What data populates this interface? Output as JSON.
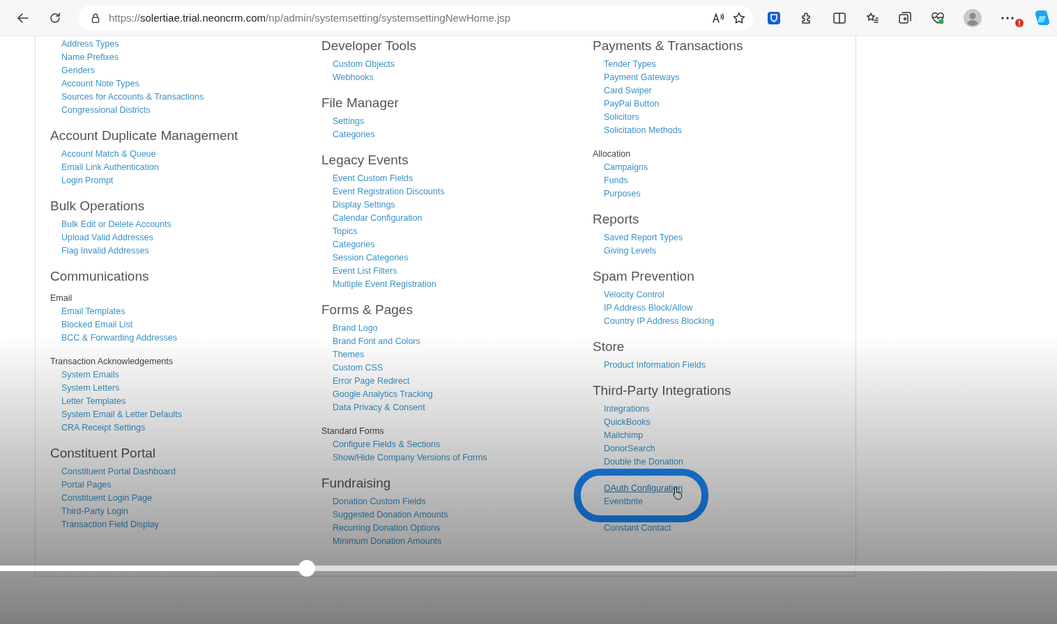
{
  "browser": {
    "url_scheme": "https://",
    "url_domain": "solertiae.trial.neoncrm.com",
    "url_path": "/np/admin/systemsetting/systemsettingNewHome.jsp"
  },
  "columns": [
    {
      "sections": [
        {
          "kind": "none",
          "links": [
            {
              "label": "Address Types"
            },
            {
              "label": "Name Prefixes"
            },
            {
              "label": "Genders"
            },
            {
              "label": "Account Note Types"
            },
            {
              "label": "Sources for Accounts & Transactions"
            },
            {
              "label": "Congressional Districts"
            }
          ]
        },
        {
          "kind": "heading",
          "title": "Account Duplicate Management",
          "links": [
            {
              "label": "Account Match & Queue"
            },
            {
              "label": "Email Link Authentication"
            },
            {
              "label": "Login Prompt"
            }
          ]
        },
        {
          "kind": "heading",
          "title": "Bulk Operations",
          "links": [
            {
              "label": "Bulk Edit or Delete Accounts"
            },
            {
              "label": "Upload Valid Addresses"
            },
            {
              "label": "Flag Invalid Addresses"
            }
          ]
        },
        {
          "kind": "heading",
          "title": "Communications"
        },
        {
          "kind": "subheading",
          "title": "Email",
          "links": [
            {
              "label": "Email Templates"
            },
            {
              "label": "Blocked Email List"
            },
            {
              "label": "BCC & Forwarding Addresses"
            }
          ]
        },
        {
          "kind": "subheading",
          "title": "Transaction Acknowledgements",
          "links": [
            {
              "label": "System Emails"
            },
            {
              "label": "System Letters"
            },
            {
              "label": "Letter Templates"
            },
            {
              "label": "System Email & Letter Defaults"
            },
            {
              "label": "CRA Receipt Settings"
            }
          ]
        },
        {
          "kind": "heading",
          "title": "Constituent Portal",
          "links": [
            {
              "label": "Constituent Portal Dashboard"
            },
            {
              "label": "Portal Pages"
            },
            {
              "label": "Constituent Login Page"
            },
            {
              "label": "Third-Party Login"
            },
            {
              "label": "Transaction Field Display"
            }
          ]
        }
      ]
    },
    {
      "sections": [
        {
          "kind": "heading",
          "title": "Developer Tools",
          "links": [
            {
              "label": "Custom Objects"
            },
            {
              "label": "Webhooks"
            }
          ]
        },
        {
          "kind": "heading",
          "title": "File Manager",
          "links": [
            {
              "label": "Settings"
            },
            {
              "label": "Categories"
            }
          ]
        },
        {
          "kind": "heading",
          "title": "Legacy Events",
          "links": [
            {
              "label": "Event Custom Fields"
            },
            {
              "label": "Event Registration Discounts"
            },
            {
              "label": "Display Settings"
            },
            {
              "label": "Calendar Configuration"
            },
            {
              "label": "Topics"
            },
            {
              "label": "Categories"
            },
            {
              "label": "Session Categories"
            },
            {
              "label": "Event List Filters"
            },
            {
              "label": "Multiple Event Registration"
            }
          ]
        },
        {
          "kind": "heading",
          "title": "Forms & Pages",
          "links": [
            {
              "label": "Brand Logo"
            },
            {
              "label": "Brand Font and Colors"
            },
            {
              "label": "Themes"
            },
            {
              "label": "Custom CSS"
            },
            {
              "label": "Error Page Redirect"
            },
            {
              "label": "Google Analytics Tracking"
            },
            {
              "label": "Data Privacy & Consent"
            }
          ]
        },
        {
          "kind": "subheading",
          "title": "Standard Forms",
          "links": [
            {
              "label": "Configure Fields & Sections"
            },
            {
              "label": "Show/Hide Company Versions of Forms"
            }
          ]
        },
        {
          "kind": "heading",
          "title": "Fundraising",
          "links": [
            {
              "label": "Donation Custom Fields"
            },
            {
              "label": "Suggested Donation Amounts"
            },
            {
              "label": "Recurring Donation Options"
            },
            {
              "label": "Minimum Donation Amounts"
            }
          ]
        }
      ]
    },
    {
      "sections": [
        {
          "kind": "heading",
          "title": "Payments & Transactions",
          "links": [
            {
              "label": "Tender Types"
            },
            {
              "label": "Payment Gateways"
            },
            {
              "label": "Card Swiper"
            },
            {
              "label": "PayPal Button"
            },
            {
              "label": "Solicitors"
            },
            {
              "label": "Solicitation Methods"
            }
          ]
        },
        {
          "kind": "subheading",
          "title": "Allocation",
          "links": [
            {
              "label": "Campaigns"
            },
            {
              "label": "Funds"
            },
            {
              "label": "Purposes"
            }
          ]
        },
        {
          "kind": "heading",
          "title": "Reports",
          "links": [
            {
              "label": "Saved Report Types"
            },
            {
              "label": "Giving Levels"
            }
          ]
        },
        {
          "kind": "heading",
          "title": "Spam Prevention",
          "links": [
            {
              "label": "Velocity Control"
            },
            {
              "label": "IP Address Block/Allow"
            },
            {
              "label": "Country IP Address Blocking"
            }
          ]
        },
        {
          "kind": "heading",
          "title": "Store",
          "links": [
            {
              "label": "Product Information Fields"
            }
          ]
        },
        {
          "kind": "heading",
          "title": "Third-Party Integrations",
          "links": [
            {
              "label": "Integrations"
            },
            {
              "label": "QuickBooks"
            },
            {
              "label": "Mailchimp"
            },
            {
              "label": "DonorSearch"
            },
            {
              "label": "Double the Donation"
            },
            {
              "label": "OAuth Configuration",
              "hovered": true,
              "circled": true
            },
            {
              "label": "Eventbrite"
            },
            {
              "label": "Constant Contact"
            }
          ]
        }
      ]
    }
  ],
  "video": {
    "progress": {
      "level": 0.29
    }
  }
}
